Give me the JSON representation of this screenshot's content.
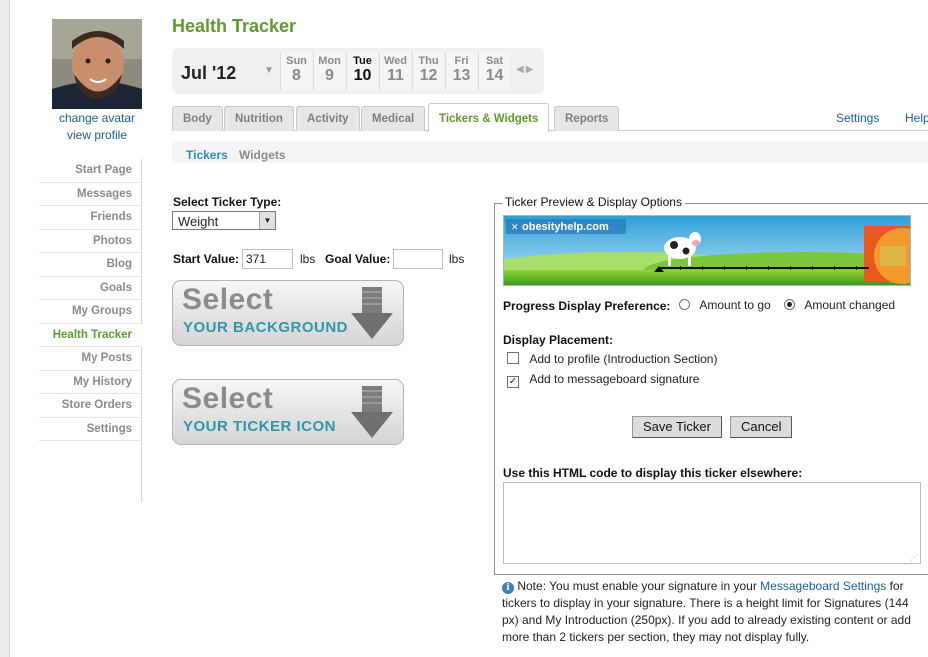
{
  "app": {
    "title": "Health Tracker"
  },
  "profile": {
    "change_avatar": "change avatar",
    "view_profile": "view profile"
  },
  "sidebar": {
    "items": [
      {
        "label": "Start Page"
      },
      {
        "label": "Messages"
      },
      {
        "label": "Friends"
      },
      {
        "label": "Photos"
      },
      {
        "label": "Blog"
      },
      {
        "label": "Goals"
      },
      {
        "label": "My Groups"
      },
      {
        "label": "Health Tracker",
        "active": true
      },
      {
        "label": "My Posts"
      },
      {
        "label": "My History"
      },
      {
        "label": "Store Orders"
      },
      {
        "label": "Settings"
      }
    ]
  },
  "datebar": {
    "month": "Jul '12",
    "days": [
      {
        "name": "Sun",
        "num": "8"
      },
      {
        "name": "Mon",
        "num": "9"
      },
      {
        "name": "Tue",
        "num": "10",
        "today": true
      },
      {
        "name": "Wed",
        "num": "11"
      },
      {
        "name": "Thu",
        "num": "12"
      },
      {
        "name": "Fri",
        "num": "13"
      },
      {
        "name": "Sat",
        "num": "14"
      }
    ]
  },
  "tabs": [
    "Body",
    "Nutrition",
    "Activity",
    "Medical",
    "Tickers & Widgets",
    "Reports"
  ],
  "active_tab": "Tickers & Widgets",
  "toplinks": {
    "settings": "Settings",
    "help": "Help"
  },
  "subtabs": {
    "tickers": "Tickers",
    "widgets": "Widgets"
  },
  "form": {
    "ticker_type_label": "Select Ticker Type:",
    "ticker_type_value": "Weight",
    "start_label": "Start Value:",
    "start_value": "371",
    "unit": "lbs",
    "goal_label": "Goal Value:",
    "goal_value": ""
  },
  "buttons": {
    "bg": {
      "line1": "Select",
      "line2": "YOUR BACKGROUND"
    },
    "icon": {
      "line1": "Select",
      "line2": "YOUR TICKER ICON"
    }
  },
  "preview": {
    "legend": "Ticker Preview & Display Options",
    "brand": "obesityhelp.com",
    "progress_label": "Progress Display Preference:",
    "opt_to_go": "Amount to go",
    "opt_changed": "Amount changed",
    "progress_selected": "Amount changed",
    "placement_label": "Display Placement:",
    "chk_profile": "Add to profile (Introduction Section)",
    "chk_profile_checked": false,
    "chk_signature": "Add to messageboard signature",
    "chk_signature_checked": true,
    "save": "Save Ticker",
    "cancel": "Cancel",
    "html_code_label": "Use this HTML code to display this ticker elsewhere:"
  },
  "note": {
    "prefix": "Note: You must enable your signature in your ",
    "link": "Messageboard Settings",
    "suffix": " for tickers to display in your signature. There is a height limit for Signatures (144 px) and My Introduction (250px). If you add to already existing content or add more than 2 tickers per section, they may not display fully."
  },
  "colors": {
    "brand_green": "#5c9b2d",
    "link_blue": "#1a5e97",
    "teal": "#2e98a8"
  }
}
